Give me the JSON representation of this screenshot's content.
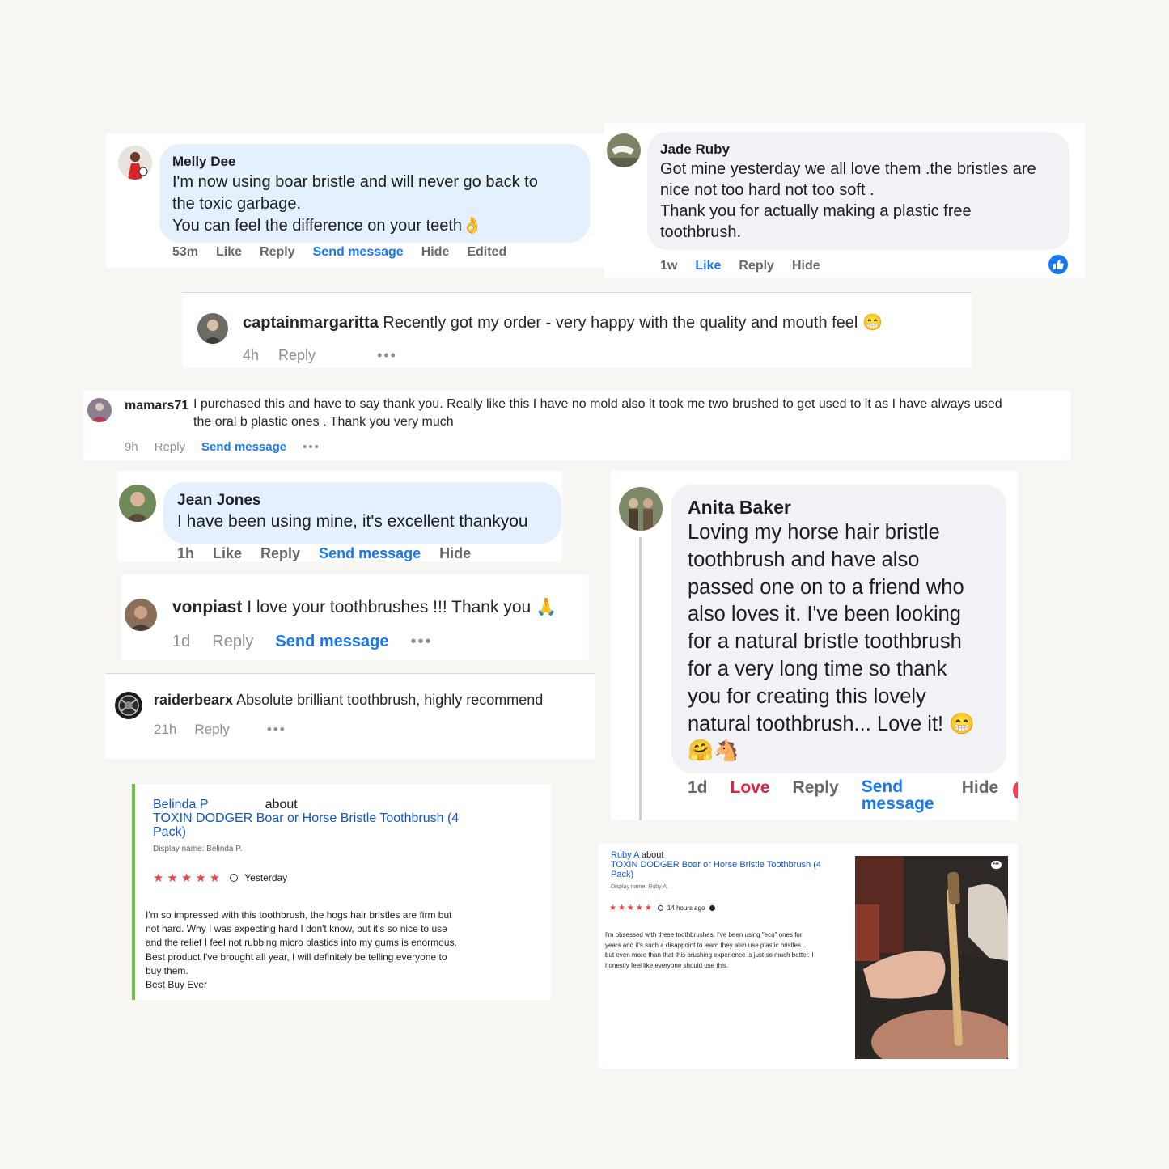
{
  "melly": {
    "name": "Melly Dee",
    "line1": "I'm now using boar bristle and will never go back to",
    "line2": "the toxic garbage.",
    "line3": "You can feel the difference on your teeth",
    "emoji": "👌",
    "time": "53m",
    "like": "Like",
    "reply": "Reply",
    "send": "Send message",
    "hide": "Hide",
    "edited": "Edited"
  },
  "jade": {
    "name": "Jade Ruby",
    "line1": "Got mine yesterday we all love them .the bristles are",
    "line2": "nice not too hard not too soft .",
    "line3": "Thank you for actually making a plastic free",
    "line4": "toothbrush.",
    "time": "1w",
    "like": "Like",
    "reply": "Reply",
    "hide": "Hide",
    "reaction_icon": "thumbs-up-icon"
  },
  "captain": {
    "name": "captainmargaritta",
    "text": "Recently got my order - very happy with the quality and mouth feel",
    "emoji": "😁",
    "time": "4h",
    "reply": "Reply",
    "more": "•••"
  },
  "mamars": {
    "name": "mamars71",
    "line1": "I purchased this and have to say thank you. Really like this I have no mold also it took me two brushed to get used to it as I have always used",
    "line2": "the oral b plastic ones . Thank you very much",
    "time": "9h",
    "reply": "Reply",
    "send": "Send message",
    "more": "•••"
  },
  "jean": {
    "name": "Jean Jones",
    "text": "I have been using mine, it's excellent thankyou",
    "time": "1h",
    "like": "Like",
    "reply": "Reply",
    "send": "Send message",
    "hide": "Hide"
  },
  "vonpiast": {
    "name": "vonpiast",
    "text": "I love your toothbrushes !!! Thank you",
    "emoji": "🙏",
    "time": "1d",
    "reply": "Reply",
    "send": "Send message",
    "more": "•••"
  },
  "raider": {
    "name": "raiderbearx",
    "text": "Absolute brilliant toothbrush, highly recommend",
    "time": "21h",
    "reply": "Reply",
    "more": "•••"
  },
  "anita": {
    "name": "Anita Baker",
    "lines": [
      "Loving my horse hair bristle",
      "toothbrush and have also",
      "passed one on to a friend who",
      "also loves it. I've been looking",
      "for a natural bristle toothbrush",
      "for a very long time so thank",
      "you for creating this lovely",
      "natural toothbrush... Love it!"
    ],
    "emoji1": "😁",
    "emoji2": "🤗🐴",
    "time": "1d",
    "love": "Love",
    "reply": "Reply",
    "send1": "Send",
    "send2": "message",
    "hide": "Hide"
  },
  "belinda": {
    "name": "Belinda P",
    "about": "about",
    "product1": "TOXIN DODGER Boar or Horse Bristle Toothbrush (4",
    "product2": "Pack)",
    "display": "Display name: Belinda P.",
    "stars": "★★★★★",
    "when": "Yesterday",
    "body": [
      "I'm so impressed with this toothbrush, the hogs hair bristles are firm but",
      "not hard. Why I was expecting hard I don't know, but it's so nice to use",
      "and the relief I feel not rubbing micro plastics into my gums is enormous.",
      "Best product I've brought all year, I will definitely be telling everyone to",
      "buy them.",
      "Best Buy Ever"
    ]
  },
  "ruby": {
    "name": "Ruby A",
    "about": "about",
    "product1": "TOXIN DODGER Boar or Horse Bristle Toothbrush (4",
    "product2": "Pack)",
    "display": "Display name: Ruby A.",
    "stars": "★★★★★",
    "when": "14 hours ago",
    "body": [
      "I'm obsessed with these toothbrushes. I've been using \"eco\" ones for",
      "years and it's such a disappoint to learn they also use plastic bristles...",
      "but even more than that this brushing experience is just so much better. I",
      "honestly feel like everyone should use this."
    ],
    "photo_more": "•••"
  },
  "colors": {
    "fb_blue": "#1877f2",
    "love_red": "#e41e3f",
    "bubble_blue": "#e4f0fd",
    "bubble_grey": "#f0f2f5",
    "star_red": "#e8434a",
    "review_green": "#6cc04a"
  }
}
